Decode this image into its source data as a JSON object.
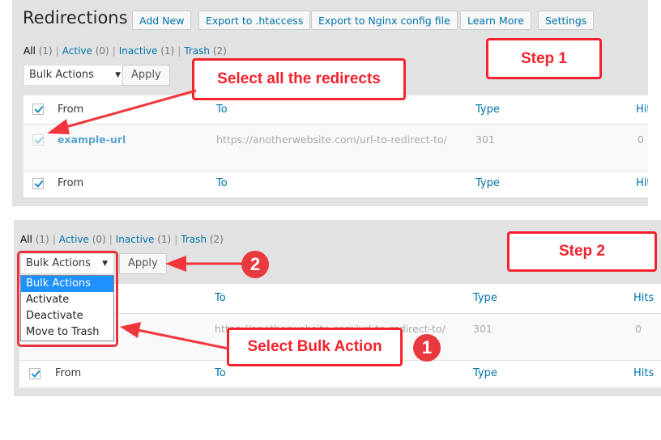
{
  "step1": {
    "page_title": "Redirections",
    "header_buttons": [
      "Add New",
      "Export to .htaccess",
      "Export to Nginx config file",
      "Learn More",
      "Settings"
    ],
    "filters": {
      "all": {
        "label": "All",
        "count": "(1)"
      },
      "active": {
        "label": "Active",
        "count": "(0)"
      },
      "inactive": {
        "label": "Inactive",
        "count": "(1)"
      },
      "trash": {
        "label": "Trash",
        "count": "(2)"
      }
    },
    "bulk_select": "Bulk Actions",
    "apply_label": "Apply",
    "columns": {
      "from": "From",
      "to": "To",
      "type": "Type",
      "hits": "Hits"
    },
    "row": {
      "from": "example-url",
      "to": "https://anotherwebsite.com/url-to-redirect-to/",
      "type": "301",
      "hits": "0",
      "checked": true
    },
    "callout": "Select all the redirects",
    "step_label": "Step 1"
  },
  "step2": {
    "filters": {
      "all": {
        "label": "All",
        "count": "(1)"
      },
      "active": {
        "label": "Active",
        "count": "(0)"
      },
      "inactive": {
        "label": "Inactive",
        "count": "(1)"
      },
      "trash": {
        "label": "Trash",
        "count": "(2)"
      }
    },
    "bulk_select": "Bulk Actions",
    "apply_label": "Apply",
    "dropdown_options": [
      "Bulk Actions",
      "Activate",
      "Deactivate",
      "Move to Trash"
    ],
    "dropdown_selected_index": 0,
    "columns": {
      "from": "From",
      "to": "To",
      "type": "Type",
      "hits": "Hits"
    },
    "row": {
      "to": "https://anotherwebsite.com/url-to-redirect-to/",
      "type": "301",
      "hits": "0"
    },
    "callout": "Select Bulk Action",
    "step_label": "Step 2",
    "badge_1": "1",
    "badge_2": "2"
  },
  "colors": {
    "annotation_red": "#f5222d",
    "link_blue": "#0073aa",
    "selected_blue": "#1e90ff"
  }
}
